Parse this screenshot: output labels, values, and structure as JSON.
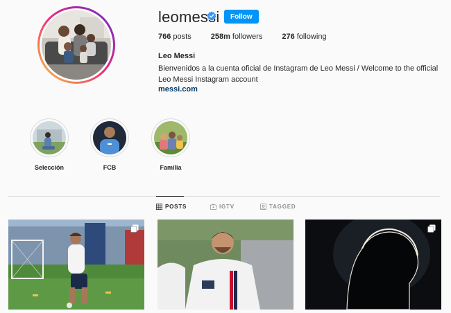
{
  "profile": {
    "username": "leomessi",
    "follow_label": "Follow",
    "posts_count": "766",
    "posts_label": "posts",
    "followers_count": "258m",
    "followers_label": "followers",
    "following_count": "276",
    "following_label": "following",
    "full_name": "Leo Messi",
    "bio": "Bienvenidos a la cuenta oficial de Instagram de Leo Messi / Welcome to the official Leo Messi Instagram account",
    "website": "messi.com"
  },
  "highlights": [
    {
      "label": "Selección"
    },
    {
      "label": "FCB"
    },
    {
      "label": "Familia"
    }
  ],
  "tabs": [
    {
      "label": "POSTS",
      "icon": "grid-icon",
      "active": true
    },
    {
      "label": "IGTV",
      "icon": "igtv-icon",
      "active": false
    },
    {
      "label": "TAGGED",
      "icon": "tagged-icon",
      "active": false
    }
  ],
  "posts": [
    {
      "icon": "multiple-posts-icon"
    },
    {
      "icon": ""
    },
    {
      "icon": "multiple-posts-icon"
    }
  ],
  "colors": {
    "accent": "#0095f6",
    "link": "#00376b",
    "verified": "#3897f0"
  }
}
